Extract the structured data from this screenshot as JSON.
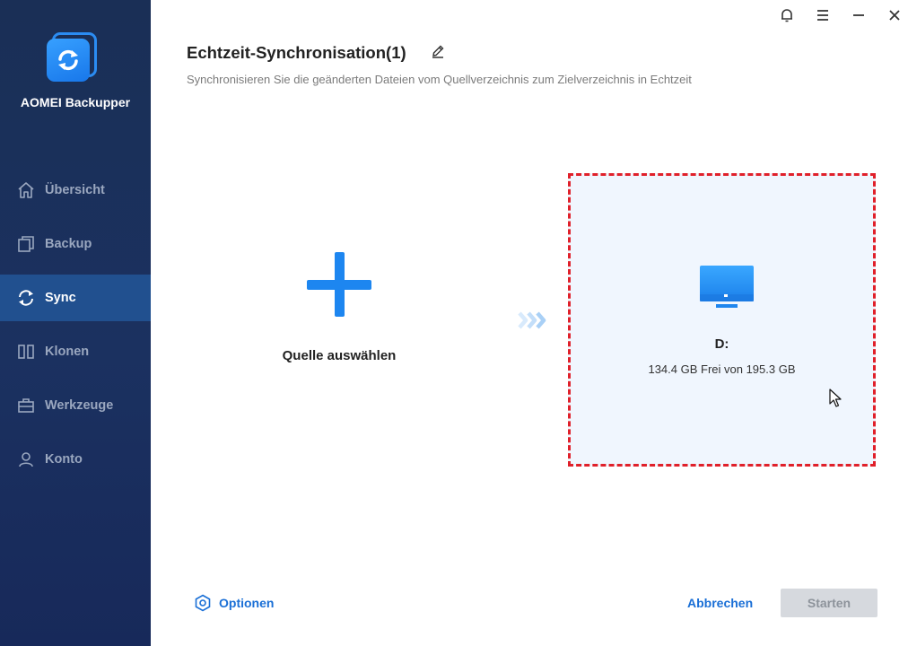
{
  "app": {
    "name": "AOMEI Backupper"
  },
  "sidebar": {
    "items": [
      {
        "label": "Übersicht",
        "icon": "home-icon",
        "active": false
      },
      {
        "label": "Backup",
        "icon": "copy-icon",
        "active": false
      },
      {
        "label": "Sync",
        "icon": "sync-icon",
        "active": true
      },
      {
        "label": "Klonen",
        "icon": "clone-icon",
        "active": false
      },
      {
        "label": "Werkzeuge",
        "icon": "toolbox-icon",
        "active": false
      },
      {
        "label": "Konto",
        "icon": "user-icon",
        "active": false
      }
    ]
  },
  "titlebar": {
    "icons": [
      "bell-icon",
      "menu-icon",
      "minimize-icon",
      "close-icon"
    ]
  },
  "header": {
    "title": "Echtzeit-Synchronisation(1)",
    "subtitle": "Synchronisieren Sie die geänderten Dateien vom Quellverzeichnis zum Zielverzeichnis in Echtzeit"
  },
  "source": {
    "label": "Quelle auswählen"
  },
  "destination": {
    "drive": "D:",
    "space": "134.4 GB Frei von 195.3 GB"
  },
  "footer": {
    "options_label": "Optionen",
    "cancel_label": "Abbrechen",
    "start_label": "Starten"
  },
  "colors": {
    "accent": "#1d86f0",
    "sidebar_bg": "#1a2f56",
    "sidebar_active": "#21508f",
    "dest_border": "#e0202a",
    "dest_bg": "#f0f6fe"
  }
}
